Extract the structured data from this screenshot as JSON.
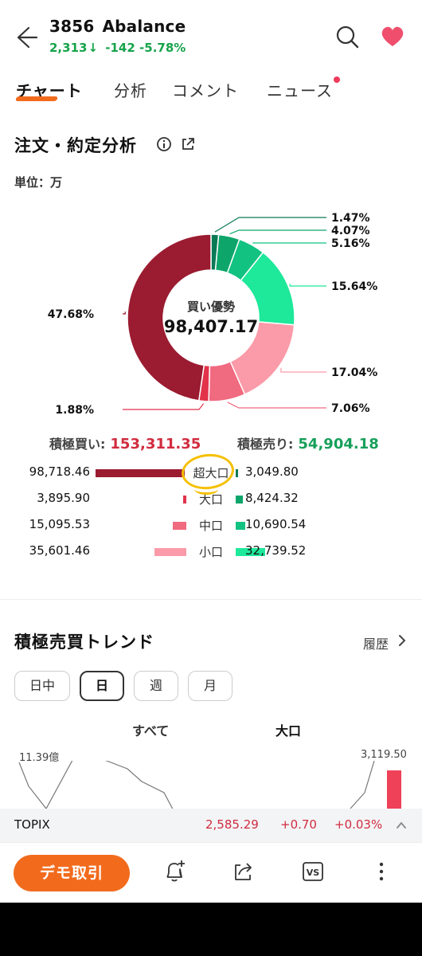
{
  "header": {
    "code": "3856",
    "name": "Abalance",
    "price": "2,313",
    "change": "-142",
    "change_pct": "-5.78%",
    "quote_color": "#16a34a"
  },
  "icons": {
    "back": "arrow-left-icon",
    "search": "search-icon",
    "favorite": "heart-icon",
    "info": "info-icon",
    "share": "share-icon",
    "history": "chevron-right-icon",
    "topix_toggle": "chevron-up-icon",
    "alert": "bell-plus-icon",
    "export": "share-arrow-icon",
    "compare": "vs-icon",
    "more": "more-vertical-icon"
  },
  "tabs": [
    {
      "label": "チャート",
      "active": true
    },
    {
      "label": "分析",
      "active": false
    },
    {
      "label": "コメント",
      "active": false
    },
    {
      "label": "ニュース",
      "active": false,
      "badge": true
    }
  ],
  "analysis": {
    "title": "注文・約定分析",
    "unit": "単位：万",
    "center_label": "買い優勢",
    "center_value": "98,407.17",
    "buy_label": "積極買い:",
    "buy_total": "153,311.35",
    "sell_label": "積極売り:",
    "sell_total": "54,904.18",
    "rows": [
      {
        "cat": "超大口",
        "buy": "98,718.46",
        "sell": "3,049.80",
        "buy_color": "#9b1b30",
        "sell_color": "#0a7a55"
      },
      {
        "cat": "大口",
        "buy": "3,895.90",
        "sell": "8,424.32",
        "buy_color": "#e2334b",
        "sell_color": "#0ea56b"
      },
      {
        "cat": "中口",
        "buy": "15,095.53",
        "sell": "10,690.54",
        "buy_color": "#f06a80",
        "sell_color": "#12c281"
      },
      {
        "cat": "小口",
        "buy": "35,601.46",
        "sell": "32,739.52",
        "buy_color": "#fb9aa8",
        "sell_color": "#1ee89a"
      }
    ]
  },
  "chart_data": {
    "type": "pie",
    "categories": [
      "超大口(売)",
      "大口(売)",
      "中口(売)",
      "小口(売)",
      "小口(買)",
      "中口(買)",
      "大口(買)",
      "超大口(買)"
    ],
    "values": [
      1.47,
      4.07,
      5.16,
      15.64,
      17.04,
      7.06,
      1.88,
      47.68
    ],
    "labels": [
      "1.47%",
      "4.07%",
      "5.16%",
      "15.64%",
      "17.04%",
      "7.06%",
      "1.88%",
      "47.68%"
    ],
    "colors": [
      "#0a7a55",
      "#0ea56b",
      "#12c281",
      "#1ee89a",
      "#fb9aa8",
      "#f06a80",
      "#e2334b",
      "#9b1b30"
    ]
  },
  "trend": {
    "title": "積極売買トレンド",
    "history_label": "履歴",
    "periods": [
      {
        "label": "日中",
        "active": false
      },
      {
        "label": "日",
        "active": true
      },
      {
        "label": "週",
        "active": false
      },
      {
        "label": "月",
        "active": false
      }
    ],
    "col_all": "すべて",
    "col_large": "大口",
    "left_axis": "11.39億",
    "right_axis": "3,119.50"
  },
  "topix": {
    "name": "TOPIX",
    "value": "2,585.29",
    "change": "+0.70",
    "change_pct": "+0.03%"
  },
  "bottom": {
    "demo_label": "デモ取引"
  }
}
